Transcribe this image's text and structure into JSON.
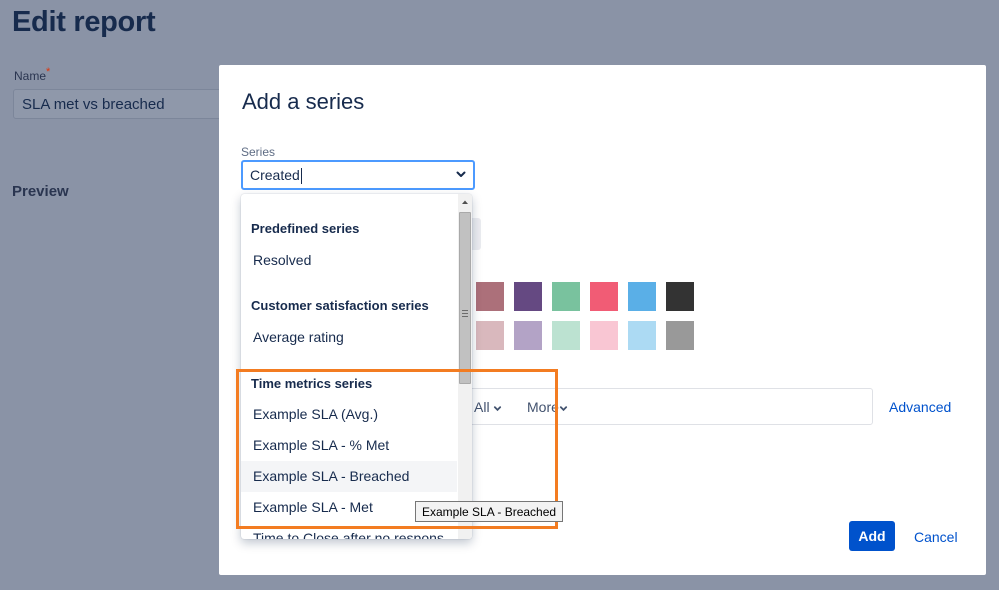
{
  "page": {
    "title": "Edit report",
    "name_label": "Name",
    "required_mark": "*",
    "name_value": "SLA met vs breached",
    "preview_label": "Preview"
  },
  "modal": {
    "title": "Add a series",
    "series_label": "Series",
    "series_value": "Created",
    "colors_row1": [
      "#ac707a",
      "#654982",
      "#79c29e",
      "#f15c75",
      "#5aafe7",
      "#333333"
    ],
    "colors_row2": [
      "#d9b8bd",
      "#b3a3c6",
      "#bce2d1",
      "#f9c6d3",
      "#acdaf3",
      "#999999"
    ],
    "filter": {
      "all_label": "All",
      "more_label": "More"
    },
    "advanced_label": "Advanced",
    "add_label": "Add",
    "cancel_label": "Cancel"
  },
  "dropdown": {
    "groups": [
      {
        "header": "Predefined series",
        "items": [
          "Resolved"
        ]
      },
      {
        "header": "Customer satisfaction series",
        "items": [
          "Average rating"
        ]
      },
      {
        "header": "Time metrics series",
        "items": [
          "Example SLA (Avg.)",
          "Example SLA - % Met",
          "Example SLA - Breached",
          "Example SLA - Met",
          "Time to Close after no respons"
        ]
      }
    ],
    "hovered_item": "Example SLA - Breached",
    "tooltip": "Example SLA - Breached"
  },
  "colors": {
    "accent": "#0052cc",
    "focus": "#4c9aff",
    "highlight": "#f37c21",
    "hover_bg": "#f4f5f7"
  }
}
